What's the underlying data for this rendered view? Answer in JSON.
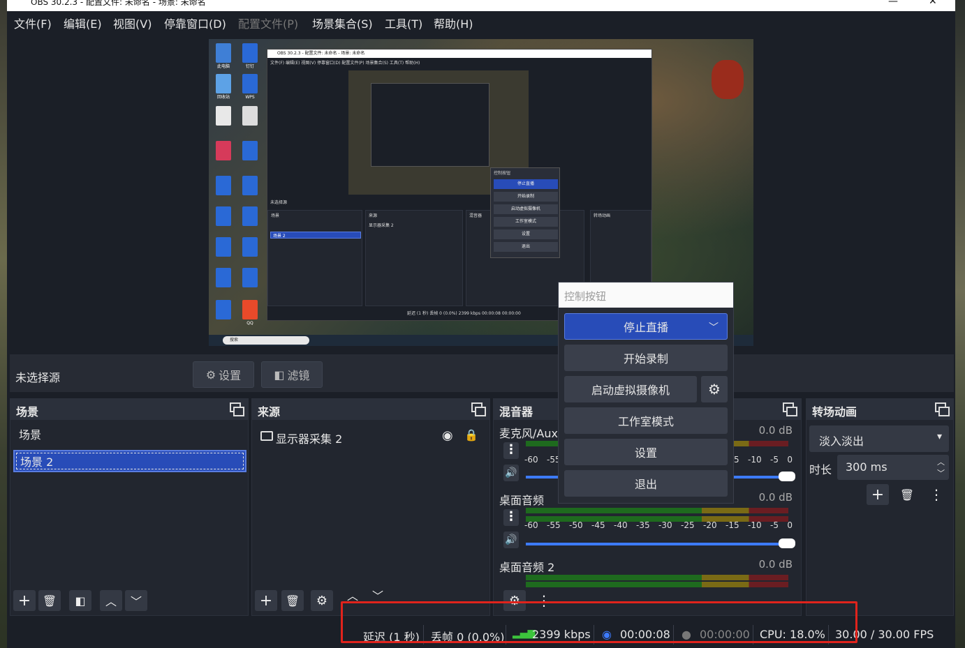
{
  "window": {
    "title": "OBS 30.2.3 - 配置文件: 未命名 - 场景: 未命名",
    "minimize": "—",
    "close": "✕"
  },
  "menu": [
    {
      "label": "文件(F)",
      "disabled": false
    },
    {
      "label": "编辑(E)",
      "disabled": false
    },
    {
      "label": "视图(V)",
      "disabled": false
    },
    {
      "label": "停靠窗口(D)",
      "disabled": false
    },
    {
      "label": "配置文件(P)",
      "disabled": true
    },
    {
      "label": "场景集合(S)",
      "disabled": false
    },
    {
      "label": "工具(T)",
      "disabled": false
    },
    {
      "label": "帮助(H)",
      "disabled": false
    }
  ],
  "preview": {
    "nested_title": "OBS 30.2.3 - 配置文件: 未命名 - 场景: 未命名",
    "nested_menu": "文件(F)  编辑(E)  视图(V)  停靠窗口(D)  配置文件(P)  场景集合(S)  工具(T)  帮助(H)",
    "nested_no_source": "未选择源",
    "nested_scenes": "场景",
    "nested_sources": "来源",
    "nested_mixer": "混音器",
    "nested_transitions": "转场动画",
    "nested_scene_item": "场景 2",
    "nested_source_item": "显示器采集 2",
    "nested_status": "延迟 (1 秒)   丢帧 0 (0.0%)   2399 kbps   00:00:08   00:00:00",
    "nested_ctrl_title": "控制按钮",
    "nested_ctrl_buttons": [
      "停止直播",
      "开始录制",
      "启动虚拟摄像机",
      "工作室模式",
      "设置",
      "退出"
    ],
    "taskbar_search": "搜索",
    "desktop_icons": [
      "此电脑",
      "钉钉",
      "回收站",
      "WPS",
      "QQ"
    ]
  },
  "source_toolbar": {
    "no_source": "未选择源",
    "settings_label": "设置",
    "filters_label": "滤镜"
  },
  "scenes": {
    "title": "场景",
    "items": [
      {
        "label": "场景",
        "selected": false
      },
      {
        "label": "场景 2",
        "selected": true
      }
    ]
  },
  "sources": {
    "title": "来源",
    "items": [
      {
        "label": "显示器采集 2"
      }
    ]
  },
  "mixer": {
    "title": "混音器",
    "channels": [
      {
        "name": "麦克风/Aux",
        "db": "0.0 dB"
      },
      {
        "name": "桌面音频",
        "db": "0.0 dB"
      },
      {
        "name": "桌面音频 2",
        "db": "0.0 dB"
      }
    ],
    "scale": [
      "-60",
      "-55",
      "-50",
      "-45",
      "-40",
      "-35",
      "-30",
      "-25",
      "-20",
      "-15",
      "-10",
      "-5",
      "0"
    ]
  },
  "transitions": {
    "title": "转场动画",
    "selected": "淡入淡出",
    "duration_label": "时长",
    "duration_value": "300 ms"
  },
  "controls": {
    "title": "控制按钮",
    "stop_stream": "停止直播",
    "start_record": "开始录制",
    "virtual_cam": "启动虚拟摄像机",
    "studio_mode": "工作室模式",
    "settings": "设置",
    "exit": "退出"
  },
  "status": {
    "delay": "延迟 (1 秒)",
    "dropped": "丢帧 0 (0.0%)",
    "bitrate": "2399 kbps",
    "stream_time": "00:00:08",
    "record_time": "00:00:00",
    "cpu": "CPU: 18.0%",
    "fps": "30.00 / 30.00 FPS"
  },
  "colors": {
    "accent": "#284cb8",
    "highlight_box": "#e0231c",
    "bitrate_icon": "#3cc43c",
    "stream_icon": "#3d7bff"
  }
}
